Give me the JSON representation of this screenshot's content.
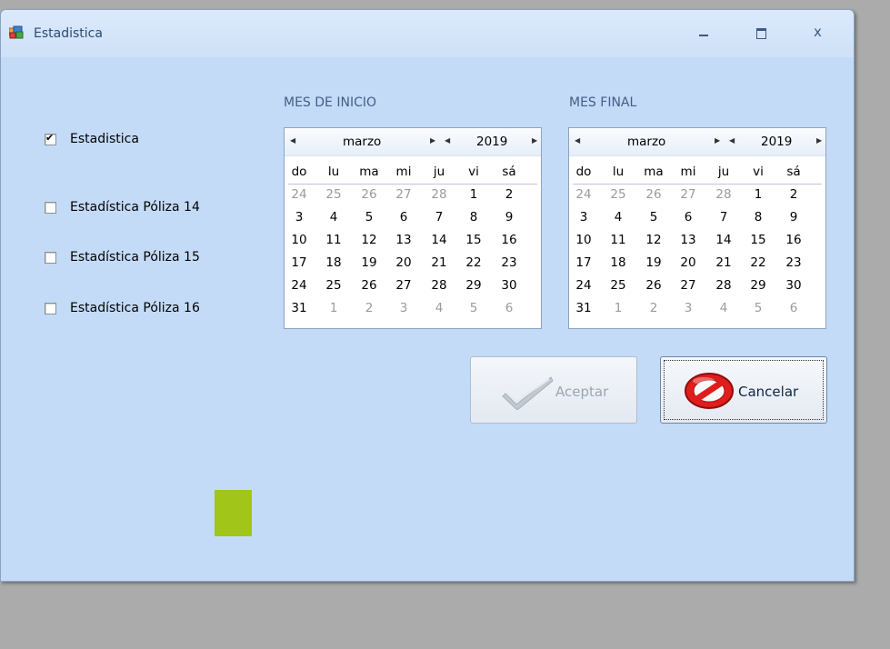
{
  "window": {
    "title": "Estadistica",
    "minimize_glyph": "_",
    "close_glyph": "x"
  },
  "checkboxes": [
    {
      "label": "Estadistica",
      "checked": true
    },
    {
      "label": "Estadística Póliza 14",
      "checked": false
    },
    {
      "label": "Estadística Póliza 15",
      "checked": false
    },
    {
      "label": "Estadística Póliza 16",
      "checked": false
    }
  ],
  "calendar_start": {
    "header": "MES DE INICIO",
    "month": "marzo",
    "year": "2019"
  },
  "calendar_end": {
    "header": "MES FINAL",
    "month": "marzo",
    "year": "2019"
  },
  "calendar": {
    "day_names": [
      "do",
      "lu",
      "ma",
      "mi",
      "ju",
      "vi",
      "sá"
    ],
    "weeks": [
      [
        "24",
        "25",
        "26",
        "27",
        "28",
        "1",
        "2"
      ],
      [
        "3",
        "4",
        "5",
        "6",
        "7",
        "8",
        "9"
      ],
      [
        "10",
        "11",
        "12",
        "13",
        "14",
        "15",
        "16"
      ],
      [
        "17",
        "18",
        "19",
        "20",
        "21",
        "22",
        "23"
      ],
      [
        "24",
        "25",
        "26",
        "27",
        "28",
        "29",
        "30"
      ],
      [
        "31",
        "1",
        "2",
        "3",
        "4",
        "5",
        "6"
      ]
    ],
    "other_month": [
      [
        true,
        true,
        true,
        true,
        true,
        false,
        false
      ],
      [
        false,
        false,
        false,
        false,
        false,
        false,
        false
      ],
      [
        false,
        false,
        false,
        false,
        false,
        false,
        false
      ],
      [
        false,
        false,
        false,
        false,
        false,
        false,
        false
      ],
      [
        false,
        false,
        false,
        false,
        false,
        false,
        false
      ],
      [
        false,
        true,
        true,
        true,
        true,
        true,
        true
      ]
    ]
  },
  "buttons": {
    "accept_label": "Aceptar",
    "cancel_label": "Cancelar"
  },
  "icons": {
    "app": "app-window-icon",
    "accept": "checkmark-icon",
    "cancel": "prohibited-icon"
  },
  "colors": {
    "form_background": "#c4dbf7",
    "indicator_green": "#a2c519",
    "cancel_icon_red": "#e01d1d",
    "header_text": "#435e88"
  }
}
